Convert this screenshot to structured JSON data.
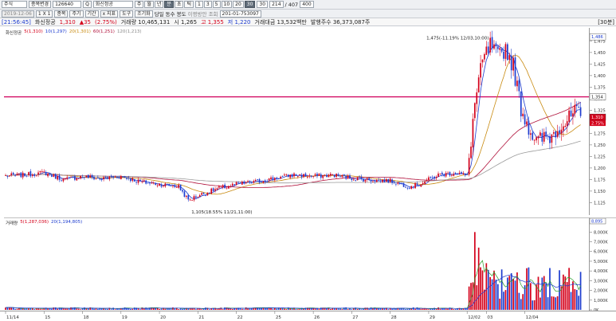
{
  "toolbar": {
    "market": "주식",
    "btn_change": "종목변경",
    "code": "126640",
    "search_btn": "Q",
    "company": "화신정공",
    "timeframes": [
      "주",
      "월",
      "년",
      "분",
      "초",
      "틱"
    ],
    "selected_timeframe": "분",
    "intervals": [
      "1",
      "3",
      "5",
      "10",
      "20",
      "30"
    ],
    "selected_interval": "30",
    "interval_value": "30",
    "count_value": "214",
    "count_total": "/ 407",
    "view_count": "400"
  },
  "toolbar2": {
    "date": "2019-12-06",
    "labels": [
      "1 X 1",
      "종목",
      "주기",
      "기간",
      "x 지표",
      "도구"
    ],
    "adjust": "조기화",
    "check1": "당일",
    "check2": "동수",
    "check3": "봉도",
    "range_label": "이평방안 조회",
    "range_value": "201-01-753097"
  },
  "infobar": {
    "time": "[21:56:45]",
    "name": "화신정공",
    "price": "1,310",
    "change": "▲35",
    "pct": "(2.75%)",
    "volume": "거래량 10,465,131",
    "open": "시 1,265",
    "high": "고 1,355",
    "low": "저 1,220",
    "amount": "거래대금 13,532백만",
    "shares": "발행주수 36,373,087주",
    "period": "[30분]"
  },
  "price_legend": [
    "화신정공",
    "5(1,310)",
    "10(1,297)",
    "20(1,301)",
    "60(1,251)",
    "120(1,213)"
  ],
  "volume_legend": [
    "거래량",
    "5(1,287,036)",
    "20(1,194,805)"
  ],
  "annotations": {
    "high": "1,475(-11.19% 12/03,10:00)",
    "low": "1,105(18.55% 11/21,11:00)",
    "line_label": "1,354",
    "current_price": "1,310",
    "current_pct": "2.75%",
    "top_label": "1,486",
    "axis_top_vol": "8,895"
  },
  "price_ticks": [
    "1,475",
    "1,450",
    "1,425",
    "1,400",
    "1,375",
    "1,350",
    "1,325",
    "1,300",
    "1,275",
    "1,250",
    "1,225",
    "1,200",
    "1,175",
    "1,150",
    "1,125"
  ],
  "volume_ticks": [
    "8,000K",
    "7,000K",
    "6,000K",
    "5,000K",
    "4,000K",
    "3,000K",
    "2,000K",
    "1,000K",
    "0K"
  ],
  "date_ticks": [
    "11/14",
    "15",
    "18",
    "19",
    "20",
    "21",
    "22",
    "25",
    "26",
    "27",
    "28",
    "29",
    "12/02",
    "03",
    "12/04"
  ],
  "colors": {
    "up": "#d4001a",
    "down": "#1d3ccf",
    "hline": "#d10b63"
  },
  "chart_data": {
    "type": "candlestick",
    "title": "화신정공 30분",
    "y_range": [
      1105,
      1486
    ],
    "hline": 1354,
    "anchors": [
      [
        0,
        1183
      ],
      [
        10,
        1185
      ],
      [
        20,
        1190
      ],
      [
        30,
        1175
      ],
      [
        40,
        1182
      ],
      [
        50,
        1176
      ],
      [
        55,
        1180
      ],
      [
        60,
        1182
      ],
      [
        70,
        1170
      ],
      [
        80,
        1165
      ],
      [
        90,
        1160
      ],
      [
        95,
        1130
      ],
      [
        100,
        1140
      ],
      [
        110,
        1155
      ],
      [
        120,
        1165
      ],
      [
        130,
        1170
      ],
      [
        140,
        1178
      ],
      [
        150,
        1185
      ],
      [
        160,
        1182
      ],
      [
        170,
        1185
      ],
      [
        180,
        1178
      ],
      [
        190,
        1174
      ],
      [
        200,
        1172
      ],
      [
        210,
        1160
      ],
      [
        215,
        1165
      ],
      [
        225,
        1185
      ],
      [
        235,
        1190
      ],
      [
        240,
        1182
      ],
      [
        244,
        1340
      ],
      [
        248,
        1430
      ],
      [
        252,
        1465
      ],
      [
        256,
        1440
      ],
      [
        260,
        1460
      ],
      [
        264,
        1420
      ],
      [
        268,
        1330
      ],
      [
        272,
        1290
      ],
      [
        276,
        1255
      ],
      [
        280,
        1265
      ],
      [
        284,
        1270
      ],
      [
        288,
        1295
      ],
      [
        292,
        1300
      ],
      [
        296,
        1320
      ],
      [
        299,
        1310
      ]
    ]
  }
}
